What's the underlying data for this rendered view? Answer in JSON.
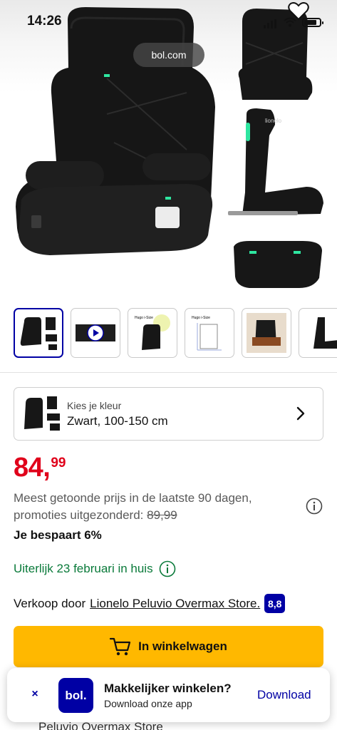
{
  "status_bar": {
    "time": "14:26"
  },
  "hero": {
    "url": "bol.com",
    "brand_label": "lionelo"
  },
  "thumbnails": [
    {
      "name": "thumb-product-overview",
      "active": true
    },
    {
      "name": "thumb-video",
      "active": false
    },
    {
      "name": "thumb-hugo-1",
      "active": false,
      "caption": "Hugo i-Size"
    },
    {
      "name": "thumb-hugo-2",
      "active": false,
      "caption": "Hugo i-Size"
    },
    {
      "name": "thumb-lifestyle",
      "active": false
    },
    {
      "name": "thumb-side",
      "active": false
    }
  ],
  "color_selector": {
    "label": "Kies je kleur",
    "value": "Zwart, 100-150 cm"
  },
  "price": {
    "main": "84,",
    "cents": "99",
    "color": "#e0001a"
  },
  "price_note": {
    "text": "Meest getoonde prijs in de laatste 90 dagen, promoties uitgezonderd:",
    "reference_price": "89,99"
  },
  "savings": "Je bespaart 6%",
  "delivery": "Uiterlijk 23 februari in huis",
  "seller": {
    "prefix": "Verkoop door",
    "name": "Lionelo Peluvio Overmax Store.",
    "rating": "8,8"
  },
  "cart_button": {
    "label": "In winkelwagen",
    "color": "#ffb800"
  },
  "below_text": "Peluvio Overmax Store",
  "app_banner": {
    "close": "×",
    "logo": "bol.",
    "title": "Makkelijker winkelen?",
    "subtitle": "Download onze app",
    "action": "Download"
  },
  "colors": {
    "brand_blue": "#0000a4",
    "green": "#0a7a3a"
  }
}
